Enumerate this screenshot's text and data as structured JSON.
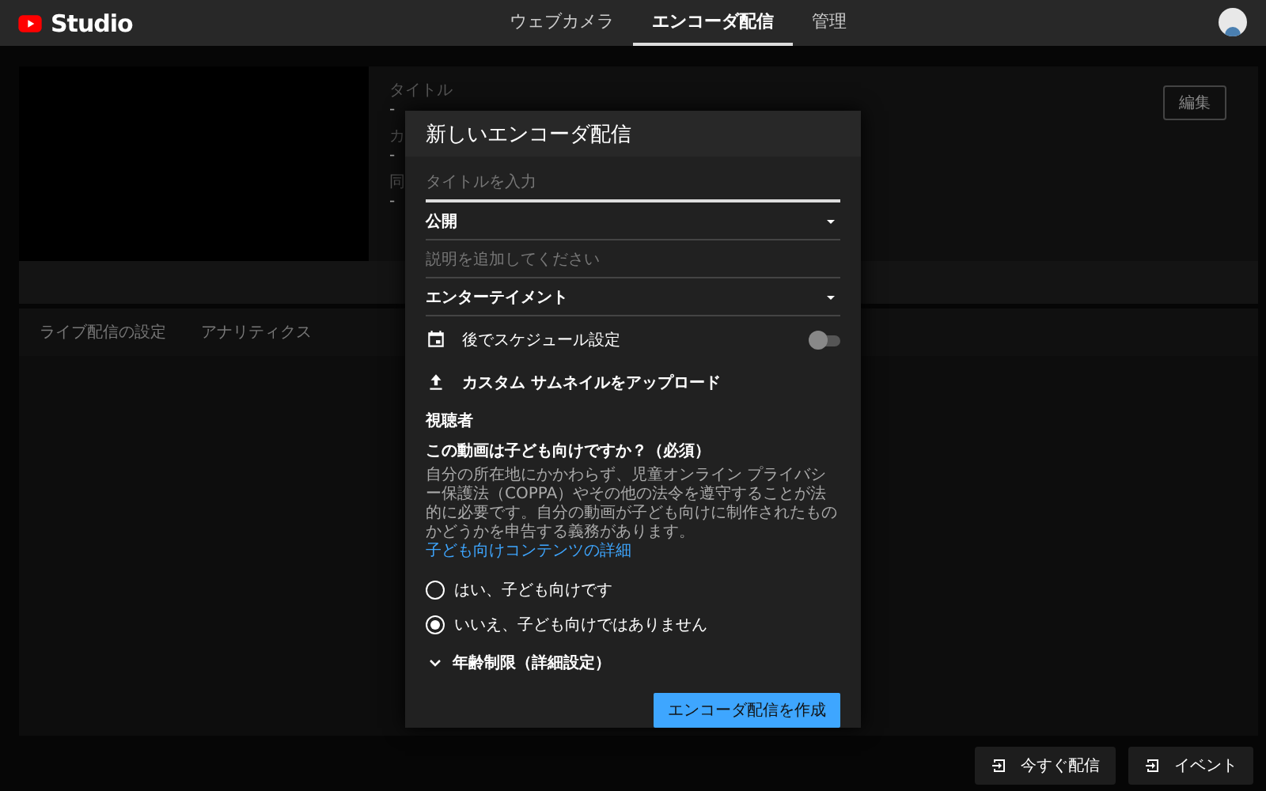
{
  "header": {
    "logo": "Studio",
    "tabs": [
      {
        "label": "ウェブカメラ",
        "selected": false
      },
      {
        "label": "エンコーダ配信",
        "selected": true
      },
      {
        "label": "管理",
        "selected": false
      }
    ]
  },
  "stream_info": {
    "fields": [
      {
        "label": "タイトル",
        "value": "-"
      },
      {
        "label": "カ",
        "value": "-"
      },
      {
        "label": "同",
        "value": "-"
      }
    ],
    "edit_button": "編集"
  },
  "section_tabs": [
    "ライブ配信の設定",
    "アナリティクス"
  ],
  "dialog": {
    "title": "新しいエンコーダ配信",
    "title_field": {
      "placeholder": "タイトルを入力"
    },
    "visibility": {
      "value": "公開"
    },
    "description": {
      "placeholder": "説明を追加してください"
    },
    "category": {
      "value": "エンターテイメント"
    },
    "schedule": {
      "label": "後でスケジュール設定",
      "on": false
    },
    "thumbnail": "カスタム サムネイルをアップロード",
    "audience": {
      "heading": "視聴者",
      "question": "この動画は子ども向けですか？（必須）",
      "description": "自分の所在地にかかわらず、児童オンライン プライバシー保護法（COPPA）やその他の法令を遵守することが法的に必要です。自分の動画が子ども向けに制作されたものかどうかを申告する義務があります。",
      "link": "子ども向けコンテンツの詳細",
      "options": [
        {
          "label": "はい、子ども向けです",
          "selected": false
        },
        {
          "label": "いいえ、子ども向けではありません",
          "selected": true
        }
      ]
    },
    "age_restriction": {
      "label": "年齢制限（詳細設定）",
      "expanded": false
    },
    "create_button": "エンコーダ配信を作成"
  },
  "actions": [
    "今すぐ配信",
    "イベント"
  ]
}
